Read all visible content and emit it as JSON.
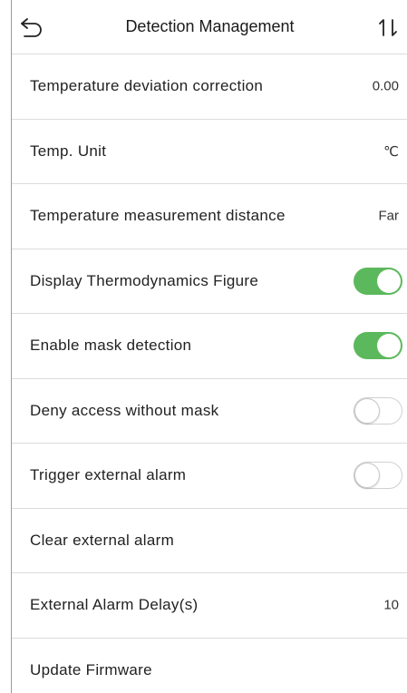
{
  "header": {
    "title": "Detection Management",
    "back_icon": "back-arrow-icon",
    "sort_icon": "sort-icon"
  },
  "colors": {
    "toggle_on": "#5cb85c",
    "toggle_off_border": "#d0d0d0",
    "divider": "#dcdcdc"
  },
  "settings": {
    "temp_deviation": {
      "label": "Temperature deviation correction",
      "value": "0.00"
    },
    "temp_unit": {
      "label": "Temp. Unit",
      "value": "℃"
    },
    "measure_distance": {
      "label": "Temperature measurement distance",
      "value": "Far"
    },
    "thermo_figure": {
      "label": "Display Thermodynamics Figure",
      "enabled": true
    },
    "mask_detection": {
      "label": "Enable mask detection",
      "enabled": true
    },
    "deny_without_mask": {
      "label": "Deny access without mask",
      "enabled": false
    },
    "trigger_alarm": {
      "label": "Trigger external alarm",
      "enabled": false
    },
    "clear_alarm": {
      "label": "Clear external alarm"
    },
    "alarm_delay": {
      "label": "External Alarm Delay(s)",
      "value": "10"
    },
    "update_firmware": {
      "label": "Update Firmware"
    }
  }
}
